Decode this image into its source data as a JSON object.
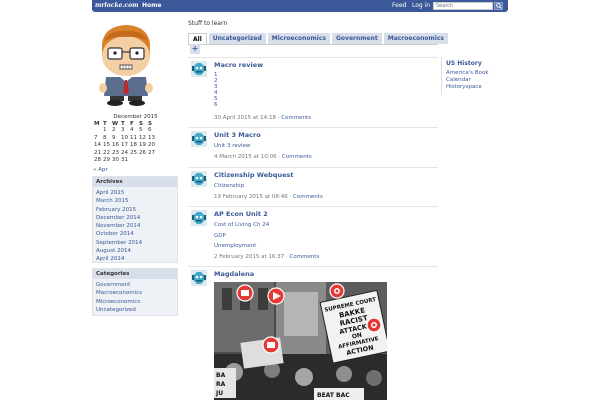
{
  "topbar": {
    "logo": "mrlocke.com",
    "home": "Home",
    "feed": "Feed",
    "login": "Log in",
    "search_placeholder": "Search",
    "search_icon": "search-icon"
  },
  "site": {
    "tagline": "Stuff to learn"
  },
  "tabs": [
    {
      "label": "All"
    },
    {
      "label": "Uncategorized"
    },
    {
      "label": "Microeconomics"
    },
    {
      "label": "Government"
    },
    {
      "label": "Macroeconomics"
    }
  ],
  "plus": "+",
  "calendar": {
    "title": "December 2015",
    "days": [
      "M",
      "T",
      "W",
      "T",
      "F",
      "S",
      "S"
    ],
    "weeks": [
      [
        "",
        "1",
        "2",
        "3",
        "4",
        "5",
        "6"
      ],
      [
        "7",
        "8",
        "9",
        "10",
        "11",
        "12",
        "13"
      ],
      [
        "14",
        "15",
        "16",
        "17",
        "18",
        "19",
        "20"
      ],
      [
        "21",
        "22",
        "23",
        "24",
        "25",
        "26",
        "27"
      ],
      [
        "28",
        "29",
        "30",
        "31",
        "",
        "",
        ""
      ]
    ],
    "prev": "« Apr"
  },
  "archives": {
    "title": "Archives",
    "items": [
      "April 2015",
      "March 2015",
      "February 2015",
      "December 2014",
      "November 2014",
      "October 2014",
      "September 2014",
      "August 2014",
      "April 2014"
    ]
  },
  "categories": {
    "title": "Categories",
    "items": [
      "Government",
      "Macroeconomics",
      "Microeconomics",
      "Uncategorized"
    ]
  },
  "posts": [
    {
      "title": "Macro review",
      "lines": [
        "1",
        "2",
        "3",
        "4",
        "5",
        "6"
      ],
      "date": "30 April 2015 at 14:18",
      "comments": "Comments"
    },
    {
      "title": "Unit 3 Macro",
      "lines": [
        "Unit 3 review"
      ],
      "date": "4 March 2015 at 10:06",
      "comments": "Comments"
    },
    {
      "title": "Citizenship Webquest",
      "lines": [
        "Citizenship"
      ],
      "date": "19 February 2015 at 08:46",
      "comments": "Comments"
    },
    {
      "title": "AP Econ Unit 2",
      "lines": [
        "Cost of Living Ch 24",
        "GDP",
        "Unemployment"
      ],
      "date": "2 February 2015 at 16:37",
      "comments": "Comments"
    },
    {
      "title": "Magdalena",
      "lines": [],
      "date": "",
      "comments": ""
    }
  ],
  "meta_sep": "·",
  "photo_signs": {
    "left": [
      "BA",
      "RA",
      "JU"
    ],
    "center": [
      "SUPREME COURT",
      "BAKKE",
      "RACIST",
      "ATTACKS",
      "ON",
      "AFFIRMATIVE",
      "ACTION"
    ],
    "bottom": "BEAT BAC"
  },
  "ushistory": {
    "title": "US History",
    "items": [
      "America's Book",
      "Calendar",
      "Historyspace"
    ]
  }
}
